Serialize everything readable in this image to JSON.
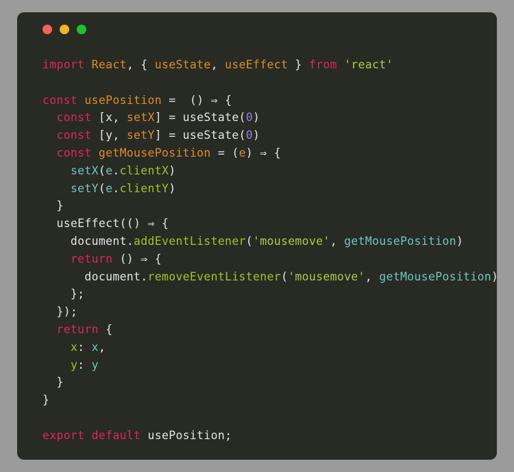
{
  "window": {
    "title_bar": {
      "buttons": [
        {
          "name": "close-button",
          "label": "",
          "color": "#f2625a"
        },
        {
          "name": "minimize-button",
          "label": "",
          "color": "#f0b429"
        },
        {
          "name": "maximize-button",
          "label": "",
          "color": "#1fc02f"
        }
      ]
    },
    "background_color": "#282a24",
    "page_background_color": "#9b9b9b"
  },
  "editor": {
    "language": "javascript",
    "theme_colors": {
      "keyword": "#e0265f",
      "function_name": "#e08b2a",
      "plain": "#e6e6e6",
      "string": "#b5c94a",
      "number": "#9a7ce0",
      "call": "#6fc7c0",
      "property": "#a5c22c"
    },
    "code_text": "import React, { useState, useEffect } from 'react'\n\nconst usePosition =  () ⇒ {\n  const [x, setX] = useState(0)\n  const [y, setY] = useState(0)\n  const getMousePosition = (e) ⇒ {\n    setX(e.clientX)\n    setY(e.clientY)\n  }\n  useEffect(() ⇒ {\n    document.addEventListener('mousemove', getMousePosition)\n    return () ⇒ {\n      document.removeEventListener('mousemove', getMousePosition)\n    };\n  });\n  return {\n    x: x,\n    y: y\n  }\n}\n\nexport default usePosition;",
    "lines": [
      {
        "n": 1,
        "tokens": [
          {
            "text": "import",
            "kind": "kw"
          },
          {
            "text": " ",
            "kind": "plain"
          },
          {
            "text": "React",
            "kind": "fn"
          },
          {
            "text": ", { ",
            "kind": "plain"
          },
          {
            "text": "useState",
            "kind": "fn"
          },
          {
            "text": ", ",
            "kind": "plain"
          },
          {
            "text": "useEffect",
            "kind": "fn"
          },
          {
            "text": " } ",
            "kind": "plain"
          },
          {
            "text": "from",
            "kind": "kw"
          },
          {
            "text": " ",
            "kind": "plain"
          },
          {
            "text": "'react'",
            "kind": "str"
          }
        ]
      },
      {
        "n": 2,
        "tokens": []
      },
      {
        "n": 3,
        "tokens": [
          {
            "text": "const",
            "kind": "kw"
          },
          {
            "text": " ",
            "kind": "plain"
          },
          {
            "text": "usePosition",
            "kind": "fn"
          },
          {
            "text": " =  () ⇒ {",
            "kind": "plain"
          }
        ]
      },
      {
        "n": 4,
        "tokens": [
          {
            "text": "  ",
            "kind": "plain"
          },
          {
            "text": "const",
            "kind": "kw"
          },
          {
            "text": " [",
            "kind": "plain"
          },
          {
            "text": "x",
            "kind": "plain"
          },
          {
            "text": ", ",
            "kind": "plain"
          },
          {
            "text": "setX",
            "kind": "fn"
          },
          {
            "text": "] = useState(",
            "kind": "plain"
          },
          {
            "text": "0",
            "kind": "num"
          },
          {
            "text": ")",
            "kind": "plain"
          }
        ]
      },
      {
        "n": 5,
        "tokens": [
          {
            "text": "  ",
            "kind": "plain"
          },
          {
            "text": "const",
            "kind": "kw"
          },
          {
            "text": " [",
            "kind": "plain"
          },
          {
            "text": "y",
            "kind": "plain"
          },
          {
            "text": ", ",
            "kind": "plain"
          },
          {
            "text": "setY",
            "kind": "fn"
          },
          {
            "text": "] = useState(",
            "kind": "plain"
          },
          {
            "text": "0",
            "kind": "num"
          },
          {
            "text": ")",
            "kind": "plain"
          }
        ]
      },
      {
        "n": 6,
        "tokens": [
          {
            "text": "  ",
            "kind": "plain"
          },
          {
            "text": "const",
            "kind": "kw"
          },
          {
            "text": " ",
            "kind": "plain"
          },
          {
            "text": "getMousePosition",
            "kind": "fn"
          },
          {
            "text": " = (",
            "kind": "plain"
          },
          {
            "text": "e",
            "kind": "fn"
          },
          {
            "text": ") ⇒ {",
            "kind": "plain"
          }
        ]
      },
      {
        "n": 7,
        "tokens": [
          {
            "text": "    ",
            "kind": "plain"
          },
          {
            "text": "setX",
            "kind": "call"
          },
          {
            "text": "(",
            "kind": "plain"
          },
          {
            "text": "e",
            "kind": "call"
          },
          {
            "text": ".",
            "kind": "plain"
          },
          {
            "text": "clientX",
            "kind": "prop"
          },
          {
            "text": ")",
            "kind": "plain"
          }
        ]
      },
      {
        "n": 8,
        "tokens": [
          {
            "text": "    ",
            "kind": "plain"
          },
          {
            "text": "setY",
            "kind": "call"
          },
          {
            "text": "(",
            "kind": "plain"
          },
          {
            "text": "e",
            "kind": "call"
          },
          {
            "text": ".",
            "kind": "plain"
          },
          {
            "text": "clientY",
            "kind": "prop"
          },
          {
            "text": ")",
            "kind": "plain"
          }
        ]
      },
      {
        "n": 9,
        "tokens": [
          {
            "text": "  }",
            "kind": "plain"
          }
        ]
      },
      {
        "n": 10,
        "tokens": [
          {
            "text": "  useEffect(() ⇒ {",
            "kind": "plain"
          }
        ]
      },
      {
        "n": 11,
        "tokens": [
          {
            "text": "    document",
            "kind": "plain"
          },
          {
            "text": ".",
            "kind": "plain"
          },
          {
            "text": "addEventListener",
            "kind": "prop"
          },
          {
            "text": "(",
            "kind": "plain"
          },
          {
            "text": "'mousemove'",
            "kind": "str"
          },
          {
            "text": ", ",
            "kind": "plain"
          },
          {
            "text": "getMousePosition",
            "kind": "call"
          },
          {
            "text": ")",
            "kind": "plain"
          }
        ]
      },
      {
        "n": 12,
        "tokens": [
          {
            "text": "    ",
            "kind": "plain"
          },
          {
            "text": "return",
            "kind": "kw"
          },
          {
            "text": " () ⇒ {",
            "kind": "plain"
          }
        ]
      },
      {
        "n": 13,
        "tokens": [
          {
            "text": "      document",
            "kind": "plain"
          },
          {
            "text": ".",
            "kind": "plain"
          },
          {
            "text": "removeEventListener",
            "kind": "prop"
          },
          {
            "text": "(",
            "kind": "plain"
          },
          {
            "text": "'mousemove'",
            "kind": "str"
          },
          {
            "text": ", ",
            "kind": "plain"
          },
          {
            "text": "getMousePosition",
            "kind": "call"
          },
          {
            "text": ")",
            "kind": "plain"
          }
        ]
      },
      {
        "n": 14,
        "tokens": [
          {
            "text": "    };",
            "kind": "plain"
          }
        ]
      },
      {
        "n": 15,
        "tokens": [
          {
            "text": "  });",
            "kind": "plain"
          }
        ]
      },
      {
        "n": 16,
        "tokens": [
          {
            "text": "  ",
            "kind": "plain"
          },
          {
            "text": "return",
            "kind": "kw"
          },
          {
            "text": " {",
            "kind": "plain"
          }
        ]
      },
      {
        "n": 17,
        "tokens": [
          {
            "text": "    ",
            "kind": "plain"
          },
          {
            "text": "x",
            "kind": "prop"
          },
          {
            "text": ": ",
            "kind": "plain"
          },
          {
            "text": "x",
            "kind": "call"
          },
          {
            "text": ",",
            "kind": "plain"
          }
        ]
      },
      {
        "n": 18,
        "tokens": [
          {
            "text": "    ",
            "kind": "plain"
          },
          {
            "text": "y",
            "kind": "prop"
          },
          {
            "text": ": ",
            "kind": "plain"
          },
          {
            "text": "y",
            "kind": "call"
          }
        ]
      },
      {
        "n": 19,
        "tokens": [
          {
            "text": "  }",
            "kind": "plain"
          }
        ]
      },
      {
        "n": 20,
        "tokens": [
          {
            "text": "}",
            "kind": "plain"
          }
        ]
      },
      {
        "n": 21,
        "tokens": []
      },
      {
        "n": 22,
        "tokens": [
          {
            "text": "export",
            "kind": "kw"
          },
          {
            "text": " ",
            "kind": "plain"
          },
          {
            "text": "default",
            "kind": "kw"
          },
          {
            "text": " usePosition;",
            "kind": "plain"
          }
        ]
      }
    ]
  }
}
